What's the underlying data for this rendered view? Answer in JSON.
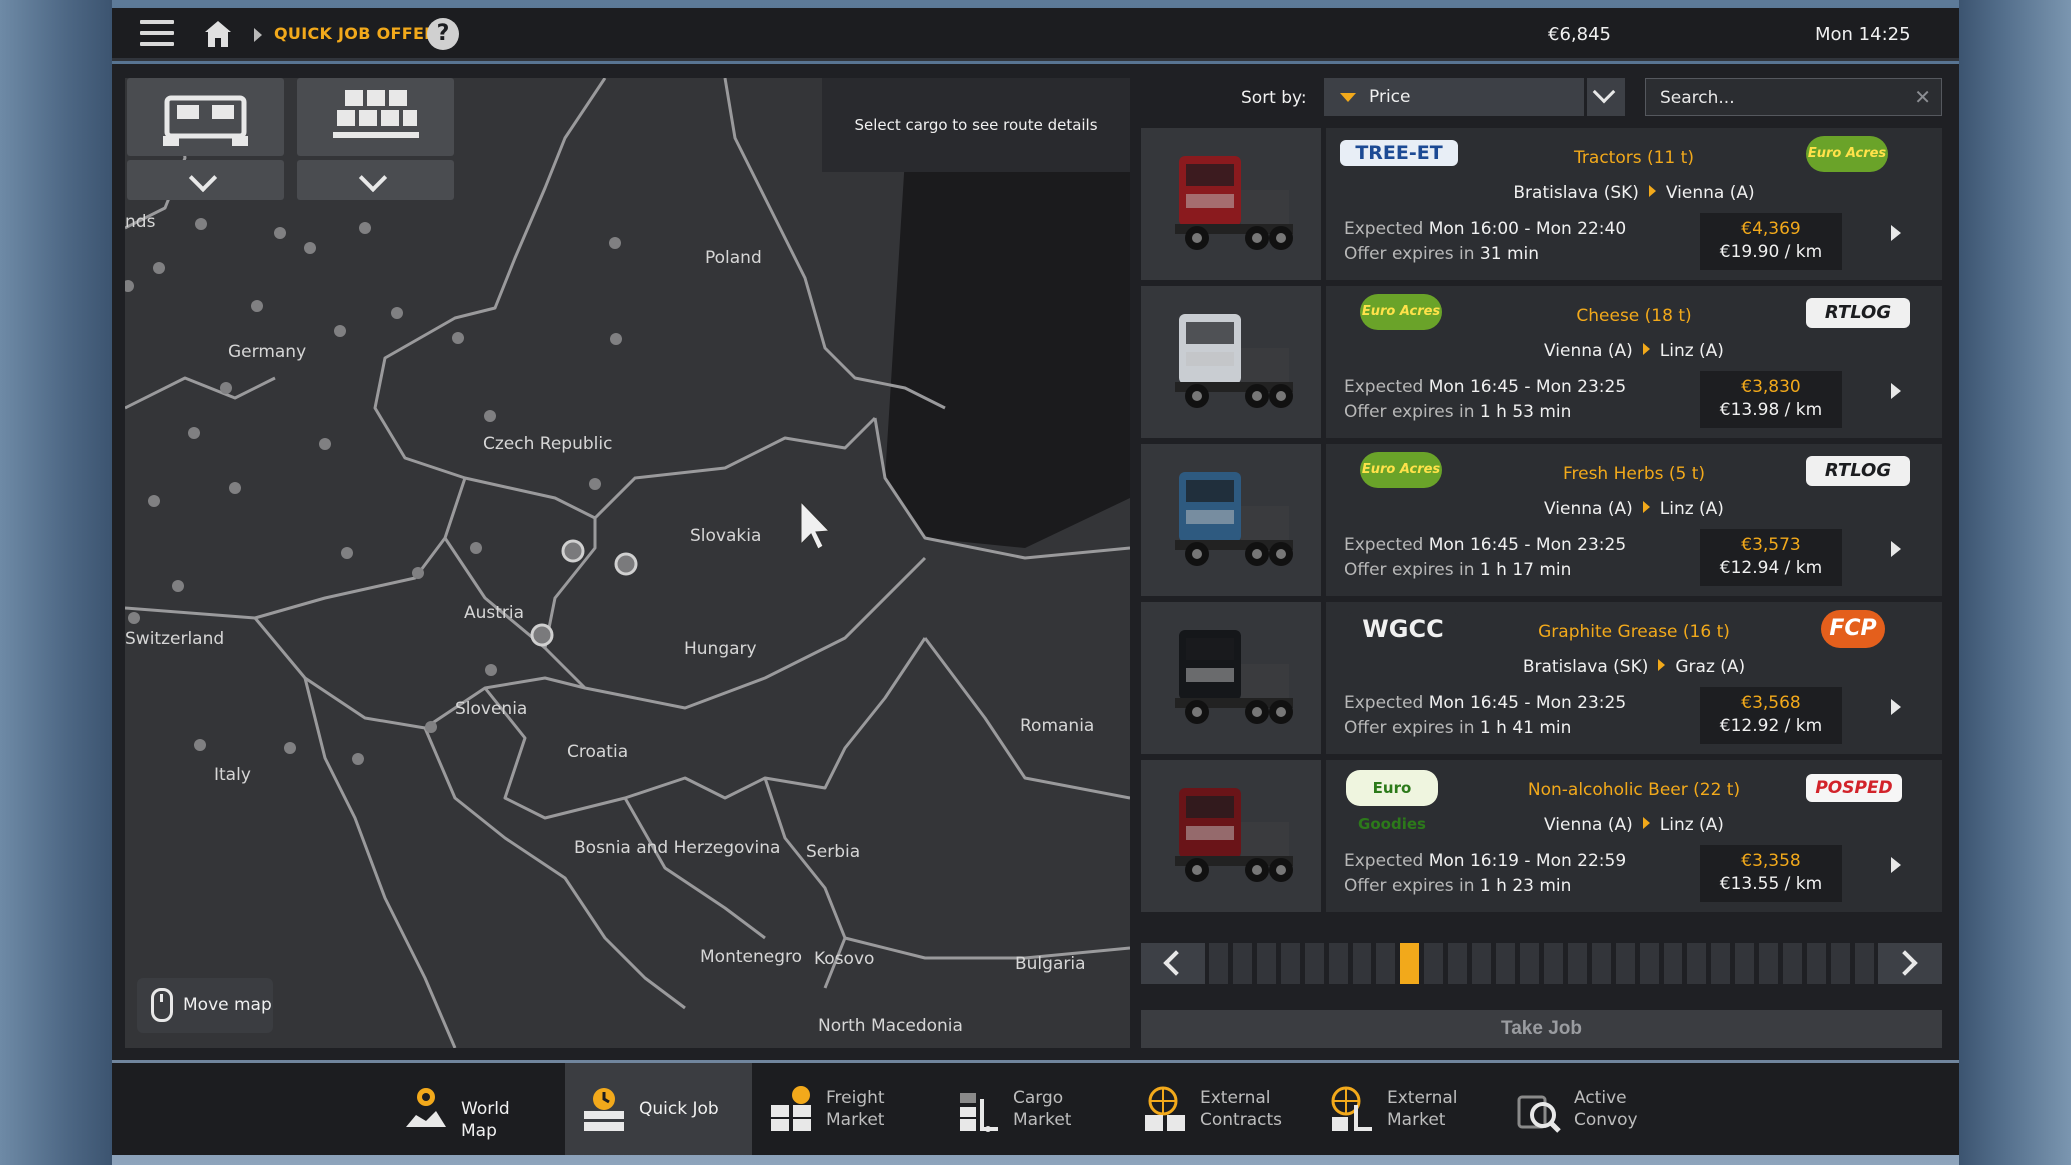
{
  "topbar": {
    "title": "QUICK JOB OFFERS",
    "help": "?",
    "money": "€6,845",
    "time": "Mon 14:25"
  },
  "map": {
    "route_hint": "Select cargo to see route details",
    "move_map": "Move map",
    "labels": [
      "nds",
      "Poland",
      "Germany",
      "Czech Republic",
      "Slovakia",
      "Austria",
      "Switzerland",
      "Hungary",
      "Slovenia",
      "Romania",
      "Croatia",
      "Italy",
      "Bosnia and Herzegovina",
      "Serbia",
      "Montenegro",
      "Kosovo",
      "Bulgaria",
      "North Macedonia"
    ]
  },
  "sort": {
    "label": "Sort by:",
    "value": "Price",
    "search_placeholder": "Search..."
  },
  "offers": [
    {
      "logo_left": "TREE-ET",
      "logo_right": "Euro Acres",
      "cargo": "Tractors (11 t)",
      "from": "Bratislava (SK)",
      "to": "Vienna (A)",
      "expected_label": "Expected",
      "expected": "Mon 16:00 - Mon 22:40",
      "expires_label": "Offer expires in",
      "expires": "31 min",
      "price": "€4,369",
      "per_km": "€19.90 / km",
      "truck_color": "#8a1a1e"
    },
    {
      "logo_left": "Euro Acres",
      "logo_right": "RTLOG",
      "cargo": "Cheese (18 t)",
      "from": "Vienna (A)",
      "to": "Linz (A)",
      "expected_label": "Expected",
      "expected": "Mon 16:45 - Mon 23:25",
      "expires_label": "Offer expires in",
      "expires": "1 h 53 min",
      "price": "€3,830",
      "per_km": "€13.98 / km",
      "truck_color": "#c9cdd2"
    },
    {
      "logo_left": "Euro Acres",
      "logo_right": "RTLOG",
      "cargo": "Fresh Herbs (5 t)",
      "from": "Vienna (A)",
      "to": "Linz (A)",
      "expected_label": "Expected",
      "expected": "Mon 16:45 - Mon 23:25",
      "expires_label": "Offer expires in",
      "expires": "1 h 17 min",
      "price": "€3,573",
      "per_km": "€12.94 / km",
      "truck_color": "#2e5a80"
    },
    {
      "logo_left": "WGCC",
      "logo_right": "FCP",
      "cargo": "Graphite Grease (16 t)",
      "from": "Bratislava (SK)",
      "to": "Graz (A)",
      "expected_label": "Expected",
      "expected": "Mon 16:45 - Mon 23:25",
      "expires_label": "Offer expires in",
      "expires": "1 h 41 min",
      "price": "€3,568",
      "per_km": "€12.92 / km",
      "truck_color": "#15171a"
    },
    {
      "logo_left": "Euro Goodies",
      "logo_right": "POSPED",
      "cargo": "Non-alcoholic Beer (22 t)",
      "from": "Vienna (A)",
      "to": "Linz (A)",
      "expected_label": "Expected",
      "expected": "Mon 16:19 - Mon 22:59",
      "expires_label": "Offer expires in",
      "expires": "1 h 23 min",
      "price": "€3,358",
      "per_km": "€13.55 / km",
      "truck_color": "#6a1418"
    }
  ],
  "pager": {
    "total": 28,
    "active": 8
  },
  "take_job": "Take Job",
  "nav": [
    {
      "label1": "World Map",
      "label2": ""
    },
    {
      "label1": "Quick Job",
      "label2": ""
    },
    {
      "label1": "Freight",
      "label2": "Market"
    },
    {
      "label1": "Cargo",
      "label2": "Market"
    },
    {
      "label1": "External",
      "label2": "Contracts"
    },
    {
      "label1": "External",
      "label2": "Market"
    },
    {
      "label1": "Active",
      "label2": "Convoy"
    }
  ],
  "colors": {
    "accent": "#f2a91b",
    "panel": "#2c2e32"
  }
}
